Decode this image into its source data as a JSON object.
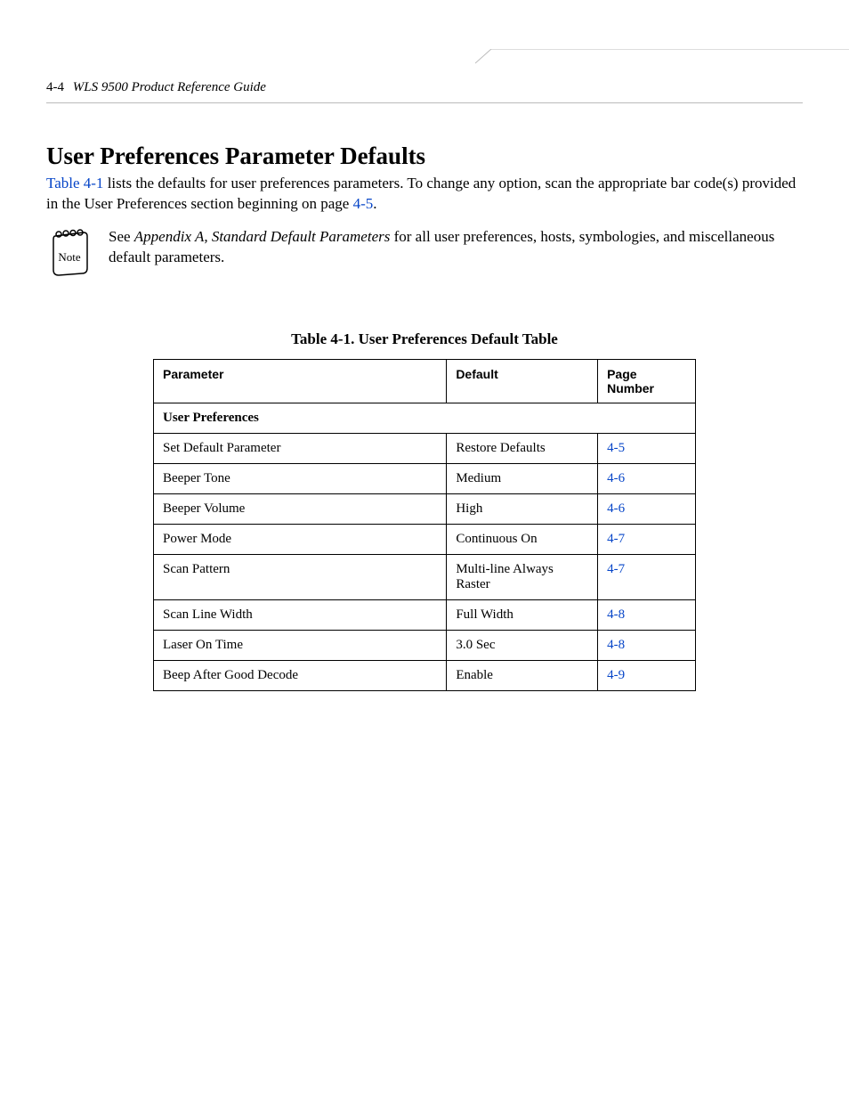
{
  "header": {
    "page_num": "4-4",
    "doc_title": "WLS 9500 Product Reference Guide"
  },
  "heading": "User Preferences Parameter Defaults",
  "intro": {
    "link1_text": "Table 4-1",
    "body1": " lists the defaults for user preferences parameters. To change any option, scan the appropriate bar code(s) provided in the User Preferences section beginning on page ",
    "link2_text": "4-5",
    "body2": "."
  },
  "note": {
    "label": "Note",
    "pre": "See ",
    "emph": "Appendix A, Standard Default Parameters",
    "post": " for all user preferences, hosts, symbologies, and miscellaneous default parameters."
  },
  "table": {
    "caption": "Table 4-1.  User Preferences Default Table",
    "headers": {
      "parameter": "Parameter",
      "default": "Default",
      "page": "Page Number"
    },
    "section_label": "User Preferences",
    "rows": [
      {
        "param": "Set Default Parameter",
        "default": "Restore Defaults",
        "page": "4-5"
      },
      {
        "param": "Beeper Tone",
        "default": "Medium",
        "page": "4-6"
      },
      {
        "param": "Beeper Volume",
        "default": "High",
        "page": "4-6"
      },
      {
        "param": "Power Mode",
        "default": "Continuous On",
        "page": "4-7"
      },
      {
        "param": "Scan Pattern",
        "default": "Multi-line Always Raster",
        "page": "4-7"
      },
      {
        "param": "Scan Line Width",
        "default": "Full Width",
        "page": "4-8"
      },
      {
        "param": "Laser On Time",
        "default": "3.0 Sec",
        "page": "4-8"
      },
      {
        "param": "Beep After Good Decode",
        "default": "Enable",
        "page": "4-9"
      }
    ]
  }
}
